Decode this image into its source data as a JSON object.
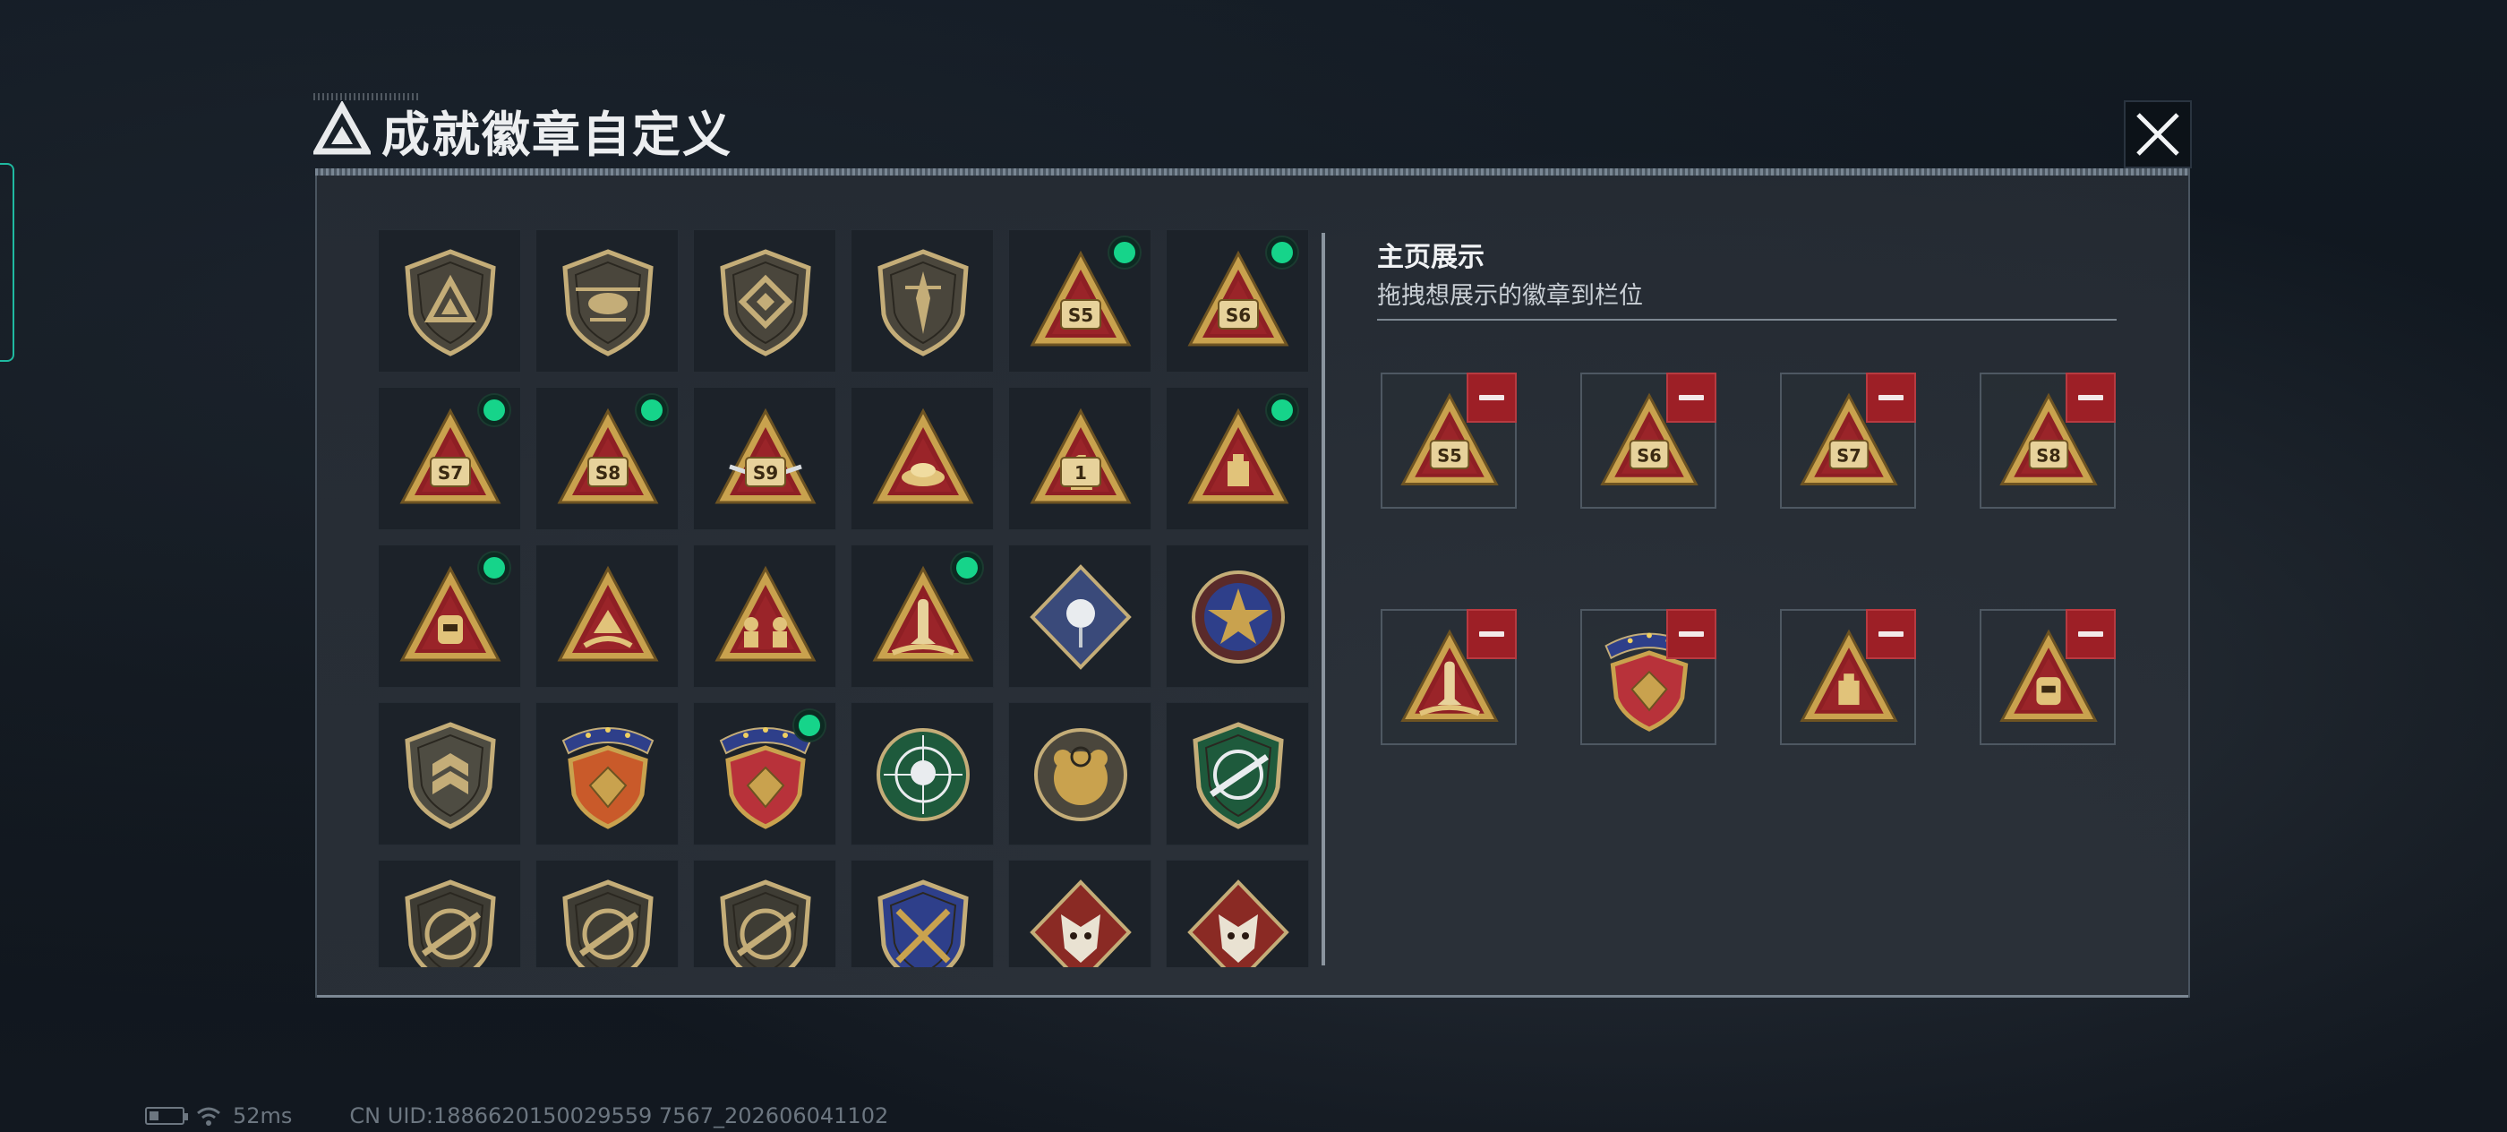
{
  "window": {
    "title": "成就徽章自定义",
    "close_icon": "close-icon"
  },
  "colors": {
    "accent_green": "#16d48a",
    "remove_red": "#9d1f26",
    "gold": "#c9a24e",
    "badge_red": "#8e1f24"
  },
  "badge_grid": {
    "cells": [
      {
        "icon": "shield-logo-badge",
        "equipped": false
      },
      {
        "icon": "shield-helicopter-badge",
        "equipped": false
      },
      {
        "icon": "shield-diamond-badge",
        "equipped": false
      },
      {
        "icon": "shield-dagger-badge",
        "equipped": false
      },
      {
        "icon": "triangle-s5-badge",
        "label": "S5",
        "equipped": true
      },
      {
        "icon": "triangle-s6-badge",
        "label": "S6",
        "equipped": true
      },
      {
        "icon": "triangle-s7-badge",
        "label": "S7",
        "equipped": true
      },
      {
        "icon": "triangle-s8-badge",
        "label": "S8",
        "equipped": true
      },
      {
        "icon": "triangle-s9-badge",
        "label": "S9",
        "equipped": false
      },
      {
        "icon": "triangle-nest-badge",
        "equipped": false
      },
      {
        "icon": "triangle-number-one-badge",
        "label": "1",
        "equipped": false
      },
      {
        "icon": "triangle-block-badge",
        "equipped": true
      },
      {
        "icon": "triangle-helmet-badge",
        "equipped": true
      },
      {
        "icon": "triangle-hands-badge",
        "equipped": false
      },
      {
        "icon": "triangle-soldiers-badge",
        "equipped": false
      },
      {
        "icon": "triangle-rocket-badge",
        "equipped": true
      },
      {
        "icon": "diamond-rose-badge",
        "equipped": false
      },
      {
        "icon": "star-medallion-badge",
        "equipped": false
      },
      {
        "icon": "shield-rank-badge",
        "equipped": false
      },
      {
        "icon": "banner-shield-gold-badge",
        "equipped": false
      },
      {
        "icon": "banner-shield-red-badge",
        "equipped": true
      },
      {
        "icon": "green-skull-crosshair-badge",
        "equipped": false
      },
      {
        "icon": "gold-bear-crosshair-badge",
        "equipped": false
      },
      {
        "icon": "green-rifle-shield-badge",
        "equipped": false
      },
      {
        "icon": "shield-rifle-badge",
        "equipped": false
      },
      {
        "icon": "shield-sniper-badge",
        "equipped": false
      },
      {
        "icon": "shield-shotgun-badge",
        "equipped": false
      },
      {
        "icon": "blue-crossed-rifles-badge",
        "equipped": false
      },
      {
        "icon": "diamond-wolf-badge",
        "equipped": false
      },
      {
        "icon": "diamond-wolf-alt-badge",
        "equipped": false
      }
    ]
  },
  "showcase": {
    "title": "主页展示",
    "subtitle": "拖拽想展示的徽章到栏位",
    "slots": [
      {
        "icon": "triangle-s5-badge",
        "label": "S5"
      },
      {
        "icon": "triangle-s6-badge",
        "label": "S6"
      },
      {
        "icon": "triangle-s7-badge",
        "label": "S7"
      },
      {
        "icon": "triangle-s8-badge",
        "label": "S8"
      },
      {
        "icon": "triangle-rocket-badge"
      },
      {
        "icon": "banner-shield-red-badge"
      },
      {
        "icon": "triangle-block-badge"
      },
      {
        "icon": "triangle-helmet-badge"
      }
    ]
  },
  "status": {
    "ping": "52ms",
    "uid": "CN UID:1886620150029559 7567_202606041102"
  }
}
